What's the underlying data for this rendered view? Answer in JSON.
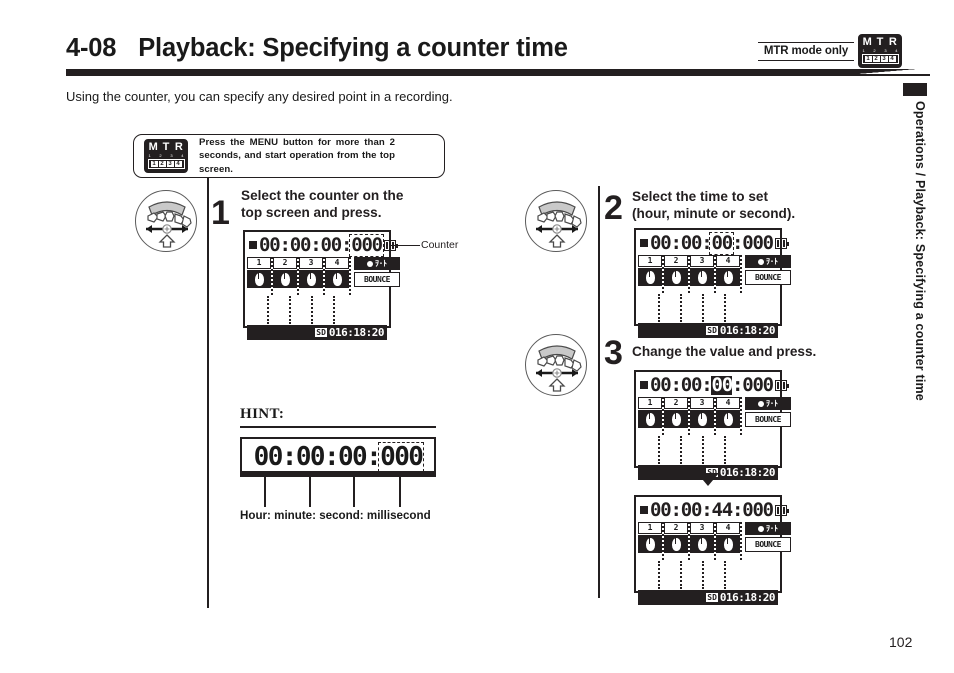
{
  "header": {
    "section_number": "4-08",
    "title": "Playback: Specifying a counter time",
    "mode_note": "MTR mode only",
    "intro": "Using the counter, you can specify any desired point in a recording.",
    "badge": {
      "letters": [
        "M",
        "T",
        "R"
      ],
      "ticks": [
        "1",
        "2",
        "3",
        "4"
      ],
      "panel": [
        "1",
        "2",
        "3",
        "4"
      ]
    }
  },
  "side_tab": {
    "text": "Operations / Playback: Specifying a counter time"
  },
  "note": {
    "text": "Press the MENU button for more than 2 seconds, and start operation from the top screen.",
    "badge": {
      "letters": [
        "M",
        "T",
        "R"
      ],
      "ticks": [
        "1",
        "2",
        "3",
        "4"
      ],
      "panel": [
        "1",
        "2",
        "3",
        "4"
      ]
    }
  },
  "callout": {
    "counter_label": "Counter"
  },
  "steps": [
    {
      "number": "1",
      "text": "Select the counter on the\ntop screen and press."
    },
    {
      "number": "2",
      "text": "Select the time to set\n(hour, minute or second)."
    },
    {
      "number": "3",
      "text": "Change the value and press."
    }
  ],
  "lcd": {
    "screen1": {
      "counter": {
        "hour": "00",
        "minute": "00",
        "second": "00",
        "millisecond": "000",
        "selection": "millisecond",
        "selection_style": "dashed"
      },
      "tracks": [
        "1",
        "2",
        "3",
        "4"
      ],
      "mode_label": "BOUNCE",
      "sd_chip": "SD",
      "sd_time": "016:18:20"
    },
    "screen2": {
      "counter": {
        "hour": "00",
        "minute": "00",
        "second": "00",
        "millisecond": "000",
        "selection": "second",
        "selection_style": "dashed"
      },
      "tracks": [
        "1",
        "2",
        "3",
        "4"
      ],
      "mode_label": "BOUNCE",
      "sd_chip": "SD",
      "sd_time": "016:18:20"
    },
    "screen3": {
      "counter": {
        "hour": "00",
        "minute": "00",
        "second": "00",
        "millisecond": "000",
        "selection": "second",
        "selection_style": "inverted"
      },
      "tracks": [
        "1",
        "2",
        "3",
        "4"
      ],
      "mode_label": "BOUNCE",
      "sd_chip": "SD",
      "sd_time": "016:18:20"
    },
    "screen4": {
      "counter": {
        "hour": "00",
        "minute": "00",
        "second": "44",
        "millisecond": "000",
        "selection": "none",
        "selection_style": "none"
      },
      "tracks": [
        "1",
        "2",
        "3",
        "4"
      ],
      "mode_label": "BOUNCE",
      "sd_chip": "SD",
      "sd_time": "016:18:20"
    },
    "separator": ":"
  },
  "hint": {
    "title": "HINT:",
    "counter": {
      "hour": "00",
      "minute": "00",
      "second": "00",
      "millisecond": "000"
    },
    "caption": "Hour: minute: second: millisecond"
  },
  "footer": {
    "page_number": "102"
  },
  "colors": {
    "ink": "#231f20",
    "paper": "#ffffff",
    "rule": "#231f20"
  }
}
